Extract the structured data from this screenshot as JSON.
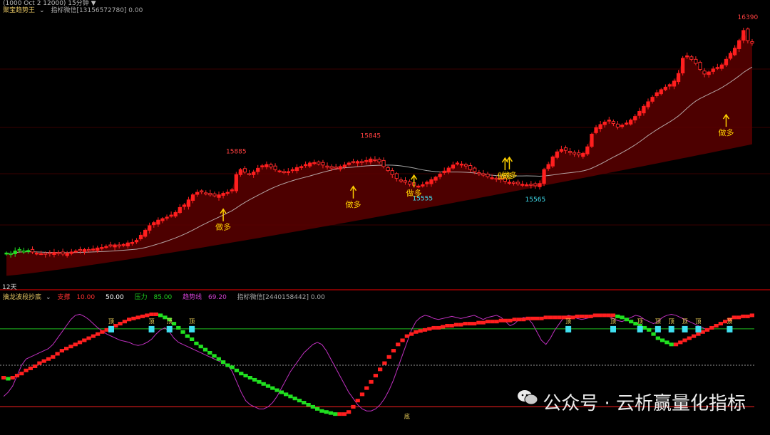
{
  "top": {
    "header_clipped": "(1000  Oct 2 12000)  15分钟 ▼",
    "indicator_name": "聚宝趋势王",
    "indicator_extra": "指标微信[13156572780] 0.00",
    "left_label": "12天"
  },
  "bottom": {
    "indicator_name": "擒龙波段抄底",
    "params": [
      {
        "label": "支撑",
        "value": "10.00",
        "color": "#ff3030"
      },
      {
        "label": "",
        "value": "50.00",
        "color": "#ffffff"
      },
      {
        "label": "压力",
        "value": "85.00",
        "color": "#20d020"
      },
      {
        "label": "趋势线",
        "value": "69.20",
        "color": "#d040d0"
      }
    ],
    "indicator_extra": "指标微信[2440158442] 0.00",
    "top_marker": "顶",
    "bottom_marker": "底"
  },
  "watermark": "公众号 · 云析赢量化指标",
  "colors": {
    "up": "#ff1f1f",
    "down": "#20e020",
    "fill": "#5a0000",
    "ma": "#d0d0d0",
    "signal": "#ffd000",
    "osc": "#c030c0",
    "cyan": "#40e0f0"
  },
  "chart_data": [
    {
      "type": "candlestick",
      "note_labels": [
        {
          "text": "15885",
          "bar": 53,
          "kind": "high"
        },
        {
          "text": "15845",
          "bar": 84,
          "kind": "high"
        },
        {
          "text": "15555",
          "bar": 96,
          "kind": "low"
        },
        {
          "text": "15565",
          "bar": 122,
          "kind": "low"
        },
        {
          "text": "16390",
          "bar": 171,
          "kind": "high"
        }
      ],
      "signals": [
        {
          "text": "做多",
          "bar": 50
        },
        {
          "text": "做多",
          "bar": 80
        },
        {
          "text": "做多",
          "bar": 94
        },
        {
          "text": "做多",
          "bar": 115
        },
        {
          "text": "做多",
          "bar": 116
        },
        {
          "text": "做多",
          "bar": 166
        }
      ],
      "close": [
        15470,
        15465,
        15478,
        15482,
        15476,
        15480,
        15474,
        15470,
        15468,
        15465,
        15468,
        15472,
        15470,
        15466,
        15470,
        15474,
        15478,
        15480,
        15484,
        15482,
        15486,
        15490,
        15492,
        15496,
        15498,
        15502,
        15500,
        15504,
        15510,
        15512,
        15520,
        15540,
        15560,
        15578,
        15590,
        15600,
        15606,
        15612,
        15620,
        15630,
        15650,
        15660,
        15680,
        15700,
        15710,
        15712,
        15706,
        15700,
        15696,
        15700,
        15706,
        15710,
        15720,
        15780,
        15800,
        15790,
        15782,
        15790,
        15805,
        15815,
        15820,
        15810,
        15800,
        15795,
        15788,
        15792,
        15800,
        15808,
        15812,
        15820,
        15826,
        15828,
        15822,
        15818,
        15812,
        15806,
        15808,
        15812,
        15818,
        15826,
        15830,
        15832,
        15828,
        15836,
        15842,
        15838,
        15830,
        15812,
        15796,
        15780,
        15765,
        15758,
        15750,
        15742,
        15738,
        15735,
        15740,
        15750,
        15760,
        15770,
        15782,
        15794,
        15806,
        15818,
        15826,
        15822,
        15814,
        15800,
        15792,
        15784,
        15778,
        15772,
        15768,
        15764,
        15760,
        15754,
        15750,
        15746,
        15744,
        15742,
        15740,
        15738,
        15736,
        15745,
        15800,
        15820,
        15850,
        15870,
        15880,
        15876,
        15868,
        15862,
        15858,
        15864,
        15890,
        15940,
        15966,
        15978,
        15988,
        15996,
        15982,
        15968,
        15976,
        15984,
        15996,
        16010,
        16030,
        16050,
        16068,
        16086,
        16104,
        16116,
        16126,
        16136,
        16150,
        16180,
        16240,
        16250,
        16236,
        16220,
        16196,
        16178,
        16186,
        16198,
        16204,
        16214,
        16236,
        16260,
        16280,
        16310,
        16350,
        16310,
        16300
      ],
      "ylim": [
        15350,
        16420
      ]
    },
    {
      "type": "line",
      "series": [
        {
          "values": [
            38,
            37,
            38,
            40,
            42,
            45,
            47,
            49,
            52,
            54,
            56,
            58,
            61,
            64,
            66,
            68,
            70,
            72,
            74,
            76,
            78,
            80,
            82,
            84,
            86,
            88,
            90,
            92,
            94,
            95,
            96,
            97,
            98,
            99,
            99,
            98,
            96,
            94,
            90,
            86,
            82,
            78,
            75,
            71,
            68,
            65,
            62,
            59,
            56,
            53,
            50,
            48,
            45,
            42,
            40,
            38,
            36,
            34,
            32,
            30,
            28,
            26,
            24,
            22,
            20,
            18,
            16,
            14,
            12,
            10,
            8,
            6,
            5,
            4,
            3,
            3,
            3,
            5,
            10,
            16,
            22,
            28,
            34,
            40,
            46,
            52,
            58,
            64,
            70,
            74,
            78,
            80,
            82,
            83,
            84,
            85,
            86,
            86,
            87,
            88,
            88,
            89,
            89,
            90,
            90,
            90,
            91,
            91,
            92,
            92,
            92,
            93,
            93,
            93,
            94,
            94,
            94,
            95,
            95,
            95,
            95,
            96,
            96,
            96,
            96,
            96,
            96,
            96,
            97,
            97,
            97,
            97,
            98,
            98,
            98,
            98,
            98,
            97,
            96,
            94,
            92,
            90,
            88,
            86,
            84,
            80,
            76,
            74,
            72,
            70,
            70,
            72,
            74,
            76,
            78,
            80,
            82,
            84,
            86,
            88,
            90,
            92,
            94,
            96,
            96,
            97,
            97,
            98
          ]
        },
        {
          "values": [
            20,
            24,
            30,
            40,
            50,
            56,
            58,
            60,
            62,
            64,
            66,
            70,
            76,
            82,
            88,
            94,
            98,
            99,
            97,
            94,
            90,
            86,
            83,
            80,
            78,
            76,
            74,
            73,
            72,
            70,
            69,
            70,
            72,
            75,
            80,
            84,
            86,
            82,
            76,
            72,
            70,
            68,
            66,
            64,
            62,
            60,
            58,
            56,
            54,
            52,
            50,
            44,
            34,
            24,
            16,
            12,
            10,
            8,
            8,
            10,
            14,
            20,
            28,
            36,
            44,
            50,
            56,
            62,
            66,
            70,
            72,
            70,
            64,
            56,
            48,
            40,
            32,
            24,
            18,
            12,
            8,
            6,
            6,
            8,
            12,
            18,
            26,
            36,
            48,
            60,
            72,
            84,
            92,
            96,
            98,
            97,
            95,
            94,
            95,
            96,
            97,
            96,
            95,
            96,
            97,
            98,
            96,
            94,
            96,
            97,
            98,
            96,
            92,
            88,
            90,
            94,
            96,
            95,
            90,
            82,
            74,
            70,
            76,
            84,
            90,
            96,
            98,
            97,
            95,
            94,
            95,
            96,
            97,
            98,
            99,
            97,
            95,
            93,
            92,
            94,
            96,
            98,
            97,
            94,
            92,
            90,
            92,
            96,
            98,
            99,
            98,
            96,
            94,
            92,
            90,
            88,
            86,
            84,
            86,
            88,
            90,
            92,
            94,
            95,
            96,
            97,
            98,
            98
          ]
        }
      ],
      "levels": {
        "support": 10,
        "mid": 50,
        "pressure": 85
      },
      "top_marks": [
        39,
        53,
        59,
        67,
        203,
        219,
        229,
        235,
        239,
        245,
        249,
        260
      ],
      "bottom_marks": [
        145
      ],
      "ylim": [
        0,
        100
      ]
    }
  ]
}
